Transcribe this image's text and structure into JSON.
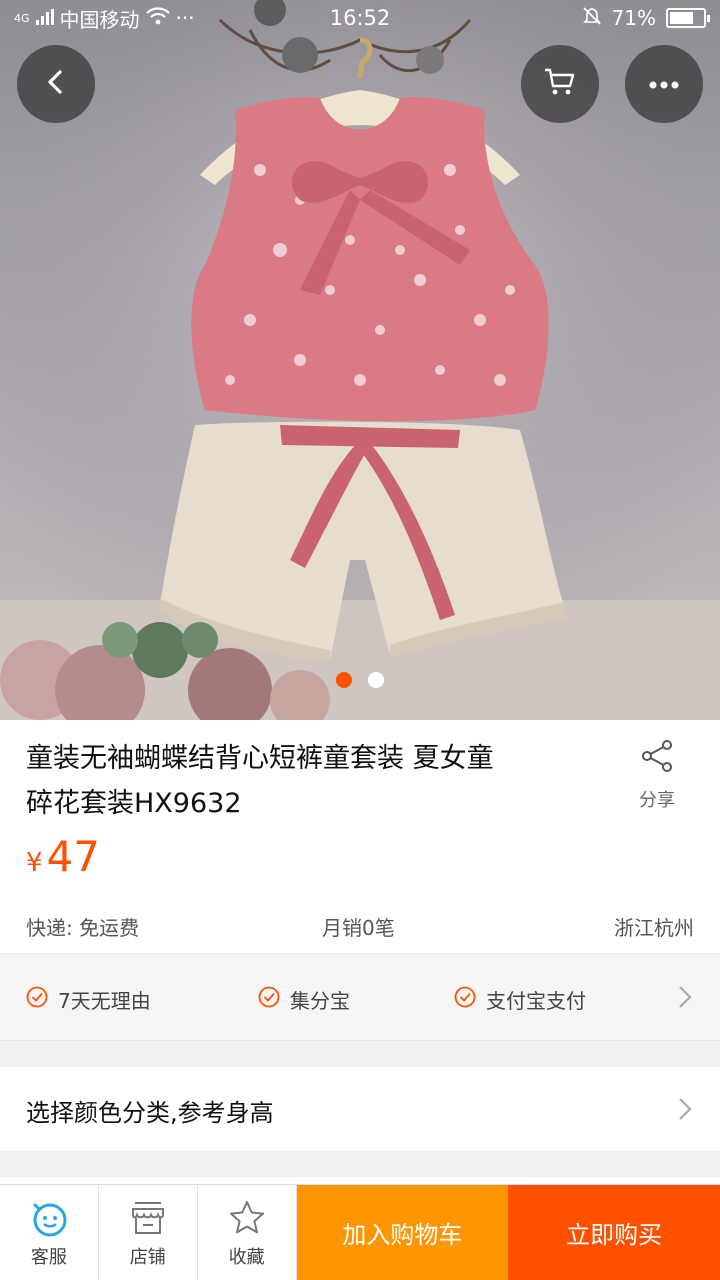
{
  "status_bar": {
    "network": "4G",
    "carrier": "中国移动",
    "time": "16:52",
    "battery_percent_text": "71%",
    "battery_level": 0.71,
    "more_indicator": "···"
  },
  "top_actions": {
    "back_icon": "chevron-left-icon",
    "cart_icon": "cart-icon",
    "more_icon": "more-icon"
  },
  "gallery": {
    "page_count": 2,
    "active_index": 0
  },
  "product": {
    "title_line1": "童装无袖蝴蝶结背心短裤童套装 夏女童",
    "title_line2": "碎花套装HX9632",
    "share_label": "分享",
    "currency": "¥",
    "price": "47"
  },
  "meta": {
    "shipping": "快递: 免运费",
    "monthly_sales": "月销0笔",
    "location": "浙江杭州"
  },
  "guarantees": [
    {
      "label": "7天无理由"
    },
    {
      "label": "集分宝"
    },
    {
      "label": "支付宝支付"
    }
  ],
  "options": {
    "label": "选择颜色分类,参考身高"
  },
  "bottom_bar": {
    "service_label": "客服",
    "shop_label": "店铺",
    "favorite_label": "收藏",
    "add_to_cart_label": "加入购物车",
    "buy_now_label": "立即购买"
  },
  "colors": {
    "accent": "#ff5000",
    "cart_button": "#ff9500"
  }
}
